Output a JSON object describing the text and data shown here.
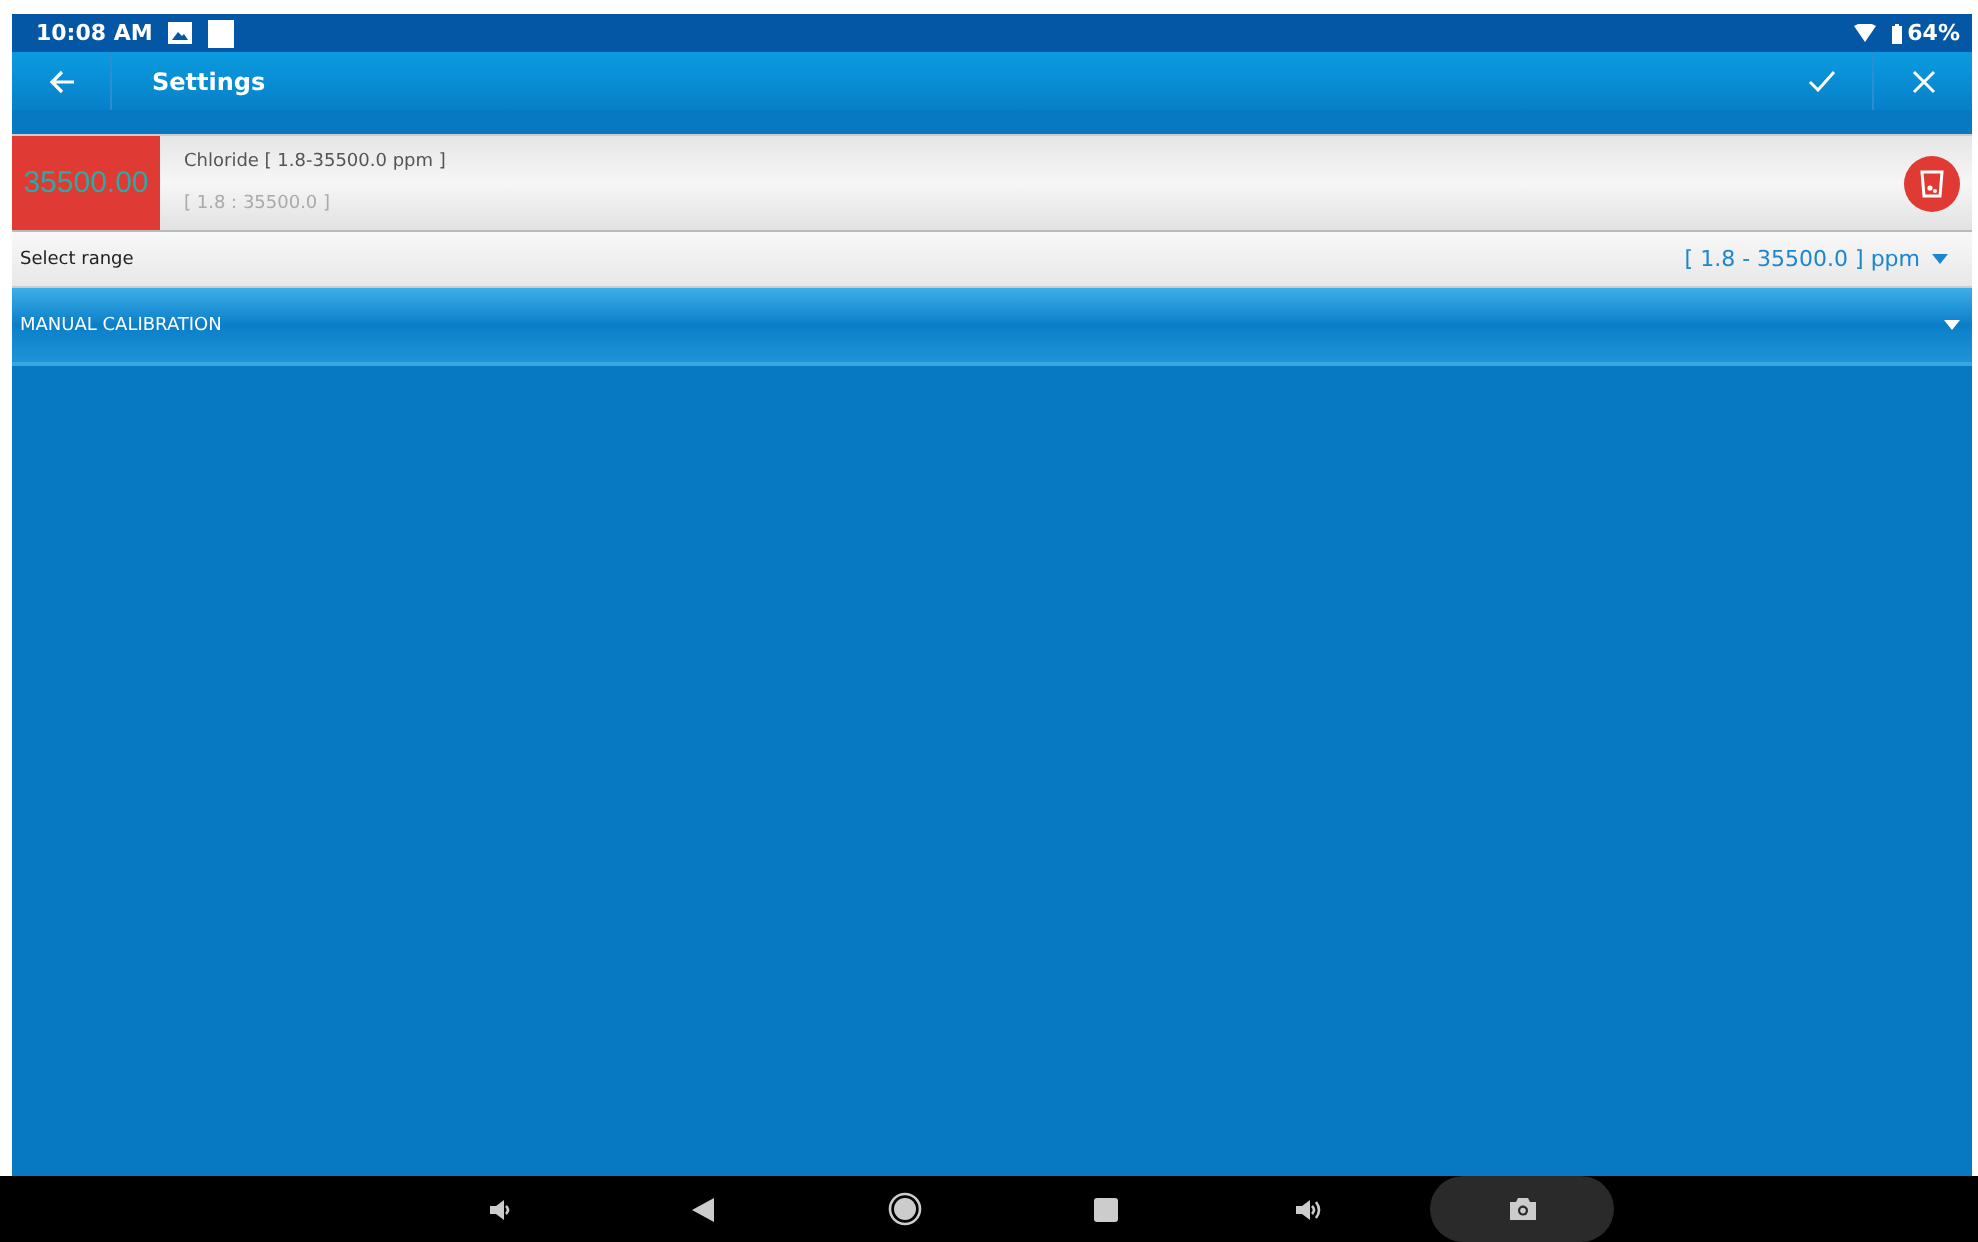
{
  "status_bar": {
    "time": "10:08 AM",
    "battery": "64%"
  },
  "app_bar": {
    "title": "Settings"
  },
  "sensor": {
    "reading": "35500.00",
    "name": "Chloride [ 1.8-35500.0 ppm ]",
    "range": "[ 1.8 : 35500.0 ]"
  },
  "range_row": {
    "label": "Select range",
    "value": "[ 1.8 - 35500.0 ] ppm"
  },
  "section": {
    "title": "MANUAL CALIBRATION",
    "expanded": false
  }
}
